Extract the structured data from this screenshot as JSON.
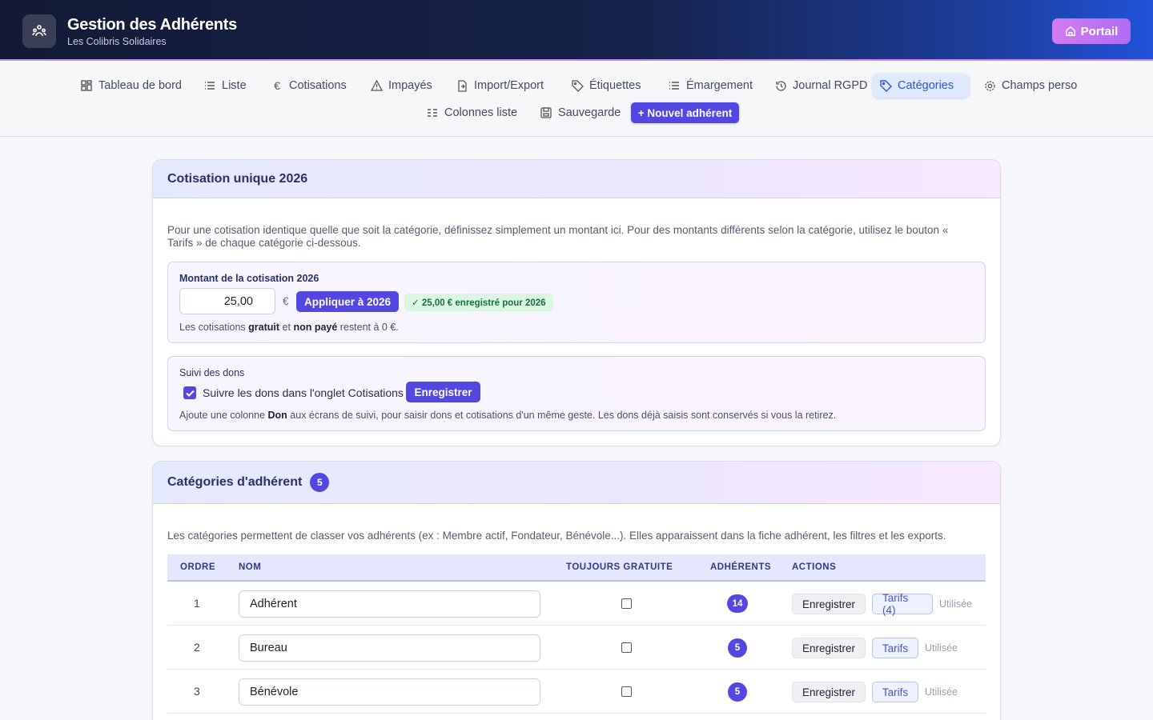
{
  "header": {
    "title": "Gestion des Adhérents",
    "subtitle": "Les Colibris Solidaires",
    "portal_label": "Portail"
  },
  "nav": {
    "items": [
      {
        "label": "Tableau de bord",
        "icon": "dashboard-grid-icon"
      },
      {
        "label": "Liste",
        "icon": "list-icon"
      },
      {
        "label": "Cotisations",
        "icon": "euro-icon"
      },
      {
        "label": "Impayés",
        "icon": "warning-icon"
      },
      {
        "label": "Import/Export",
        "icon": "file-transfer-icon"
      },
      {
        "label": "Étiquettes",
        "icon": "tag-icon"
      },
      {
        "label": "Émargement",
        "icon": "checklist-icon"
      },
      {
        "label": "Journal RGPD",
        "icon": "history-icon"
      },
      {
        "label": "Catégories",
        "icon": "tag-icon",
        "active": true
      },
      {
        "label": "Champs perso",
        "icon": "gear-icon"
      },
      {
        "label": "Colonnes liste",
        "icon": "columns-icon"
      },
      {
        "label": "Sauvegarde",
        "icon": "save-icon"
      }
    ],
    "new_member_label": "+ Nouvel adhérent"
  },
  "fee_card": {
    "title": "Cotisation unique 2026",
    "description": "Pour une cotisation identique quelle que soit la catégorie, définissez simplement un montant ici. Pour des montants différents selon la catégorie, utilisez le bouton « Tarifs » de chaque catégorie ci-dessous.",
    "amount_label": "Montant de la cotisation 2026",
    "amount_value": "25,00",
    "currency": "€",
    "apply_label": "Appliquer à 2026",
    "saved_badge": "✓ 25,00 € enregistré pour 2026",
    "note_prefix": "Les cotisations ",
    "note_bold1": "gratuit",
    "note_mid": " et ",
    "note_bold2": "non payé",
    "note_suffix": " restent à 0 €.",
    "donations_label": "Suivi des dons",
    "donations_checkbox_label": "Suivre les dons dans l'onglet Cotisations",
    "donations_checked": true,
    "donations_save_label": "Enregistrer",
    "donations_note_prefix": "Ajoute une colonne ",
    "donations_note_bold": "Don",
    "donations_note_suffix": " aux écrans de suivi, pour saisir dons et cotisations d'un même geste. Les dons déjà saisis sont conservés si vous la retirez."
  },
  "categories_card": {
    "title": "Catégories d'adhérent",
    "count": "5",
    "description": "Les catégories permettent de classer vos adhérents (ex : Membre actif, Fondateur, Bénévole...). Elles apparaissent dans la fiche adhérent, les filtres et les exports.",
    "columns": [
      "ORDRE",
      "NOM",
      "TOUJOURS GRATUITE",
      "ADHÉRENTS",
      "ACTIONS"
    ],
    "rows": [
      {
        "order": "1",
        "name": "Adhérent",
        "always_free": false,
        "members": "14",
        "save": "Enregistrer",
        "tarifs": "Tarifs (4)",
        "status": "Utilisée"
      },
      {
        "order": "2",
        "name": "Bureau",
        "always_free": false,
        "members": "5",
        "save": "Enregistrer",
        "tarifs": "Tarifs",
        "status": "Utilisée"
      },
      {
        "order": "3",
        "name": "Bénévole",
        "always_free": false,
        "members": "5",
        "save": "Enregistrer",
        "tarifs": "Tarifs",
        "status": "Utilisée"
      }
    ]
  },
  "colors": {
    "accent": "#5446e0",
    "active_nav": "#2a56d8",
    "success_bg": "#dcf6e3",
    "portal": "#c774f3"
  }
}
